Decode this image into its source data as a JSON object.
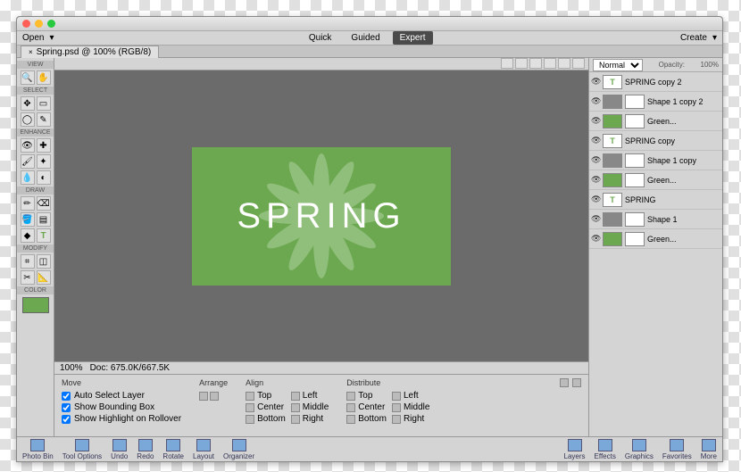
{
  "titlebar": {},
  "menubar": {
    "open": "Open",
    "modes": [
      "Quick",
      "Guided",
      "Expert"
    ],
    "active_mode": 2,
    "create": "Create"
  },
  "tab": {
    "title": "Spring.psd @ 100% (RGB/8)"
  },
  "toolbar": {
    "sections": [
      "VIEW",
      "SELECT",
      "ENHANCE",
      "DRAW",
      "MODIFY",
      "COLOR"
    ],
    "color_swatch": "#6ba84f"
  },
  "canvas": {
    "text": "SPRING",
    "status_zoom": "100%",
    "status_doc": "Doc: 675.0K/667.5K"
  },
  "rightpanel": {
    "blend": "Normal",
    "opacity_label": "Opacity:",
    "opacity": "100%",
    "layers": [
      {
        "type": "t",
        "name": "SPRING copy 2"
      },
      {
        "type": "s",
        "name": "Shape 1 copy 2",
        "mask": true
      },
      {
        "type": "g",
        "name": "Green...",
        "mask": true
      },
      {
        "type": "t",
        "name": "SPRING copy"
      },
      {
        "type": "s",
        "name": "Shape 1 copy",
        "mask": true
      },
      {
        "type": "g",
        "name": "Green...",
        "mask": true
      },
      {
        "type": "t",
        "name": "SPRING"
      },
      {
        "type": "s",
        "name": "Shape 1",
        "mask": true
      },
      {
        "type": "g",
        "name": "Green...",
        "mask": true
      }
    ]
  },
  "options": {
    "tool": "Move",
    "checks": [
      "Auto Select Layer",
      "Show Bounding Box",
      "Show Highlight on Rollover"
    ],
    "arrange": "Arrange",
    "align": {
      "title": "Align",
      "items": [
        "Top",
        "Left",
        "Center",
        "Middle",
        "Bottom",
        "Right"
      ]
    },
    "distribute": {
      "title": "Distribute",
      "items": [
        "Top",
        "Left",
        "Center",
        "Middle",
        "Bottom",
        "Right"
      ]
    }
  },
  "bottombar": {
    "left": [
      "Photo Bin",
      "Tool Options",
      "Undo",
      "Redo",
      "Rotate",
      "Layout",
      "Organizer"
    ],
    "right": [
      "Layers",
      "Effects",
      "Graphics",
      "Favorites",
      "More"
    ]
  }
}
